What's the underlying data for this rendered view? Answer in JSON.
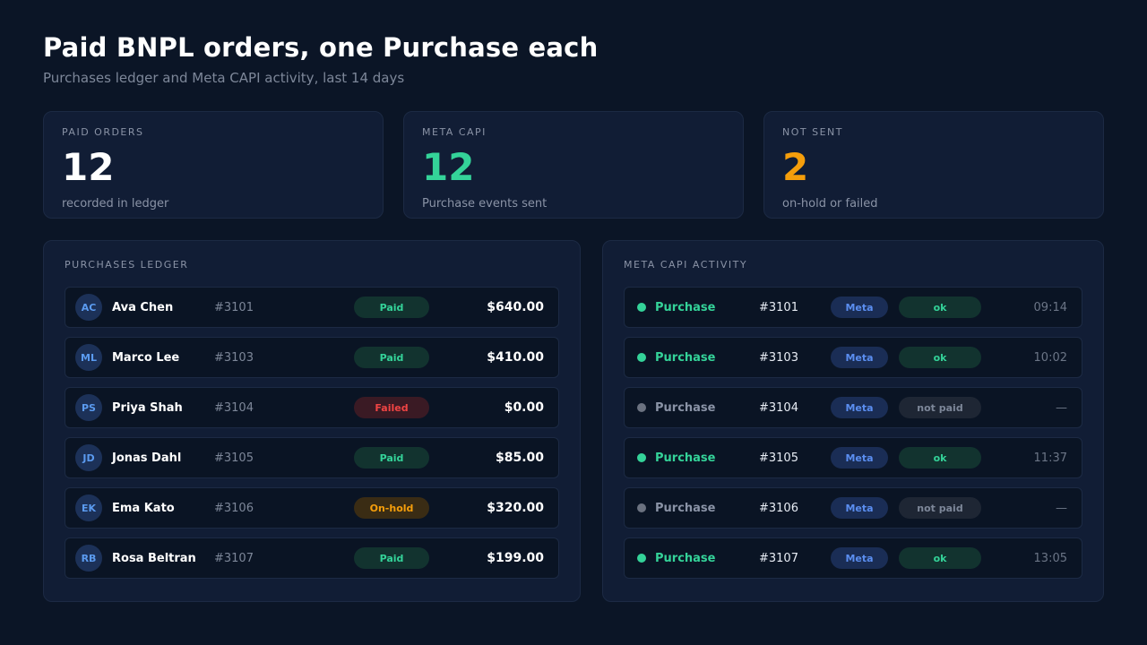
{
  "header": {
    "title": "Paid BNPL orders, one Purchase each",
    "subtitle": "Purchases ledger and Meta CAPI activity, last 14 days"
  },
  "stats": [
    {
      "label": "PAID ORDERS",
      "value": "12",
      "desc": "recorded in ledger",
      "color": "#ffffff"
    },
    {
      "label": "META CAPI",
      "value": "12",
      "desc": "Purchase events sent",
      "color": "#34d399"
    },
    {
      "label": "NOT SENT",
      "value": "2",
      "desc": "on-hold or failed",
      "color": "#f59e0b"
    }
  ],
  "ledger": {
    "title": "PURCHASES LEDGER",
    "rows": [
      {
        "initials": "AC",
        "name": "Ava Chen",
        "order": "#3101",
        "status": "Paid",
        "amount": "$640.00"
      },
      {
        "initials": "ML",
        "name": "Marco Lee",
        "order": "#3103",
        "status": "Paid",
        "amount": "$410.00"
      },
      {
        "initials": "PS",
        "name": "Priya Shah",
        "order": "#3104",
        "status": "Failed",
        "amount": "$0.00"
      },
      {
        "initials": "JD",
        "name": "Jonas Dahl",
        "order": "#3105",
        "status": "Paid",
        "amount": "$85.00"
      },
      {
        "initials": "EK",
        "name": "Ema Kato",
        "order": "#3106",
        "status": "On-hold",
        "amount": "$320.00"
      },
      {
        "initials": "RB",
        "name": "Rosa Beltran",
        "order": "#3107",
        "status": "Paid",
        "amount": "$199.00"
      }
    ]
  },
  "capi": {
    "title": "META CAPI ACTIVITY",
    "rows": [
      {
        "event": "Purchase",
        "order": "#3101",
        "channel": "Meta",
        "result": "ok",
        "time": "09:14"
      },
      {
        "event": "Purchase",
        "order": "#3103",
        "channel": "Meta",
        "result": "ok",
        "time": "10:02"
      },
      {
        "event": "Purchase",
        "order": "#3104",
        "channel": "Meta",
        "result": "not paid",
        "time": "—"
      },
      {
        "event": "Purchase",
        "order": "#3105",
        "channel": "Meta",
        "result": "ok",
        "time": "11:37"
      },
      {
        "event": "Purchase",
        "order": "#3106",
        "channel": "Meta",
        "result": "not paid",
        "time": "—"
      },
      {
        "event": "Purchase",
        "order": "#3107",
        "channel": "Meta",
        "result": "ok",
        "time": "13:05"
      }
    ]
  },
  "colors": {
    "background": "#0b1526",
    "panel": "#111d35",
    "accent_green": "#34d399",
    "accent_orange": "#f59e0b",
    "accent_red": "#ef4444",
    "accent_blue": "#5b8ef0"
  }
}
